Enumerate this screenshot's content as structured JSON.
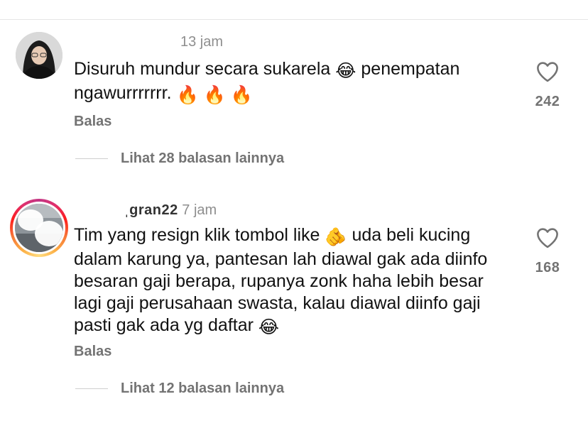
{
  "comments": [
    {
      "username": "",
      "time": "13 jam",
      "text_a": "Disuruh mundur secara sukarela ",
      "emoji_a": "😂",
      "text_b": "  penempatan ngawurrrrrrr. ",
      "emoji_b": "🔥 🔥 🔥",
      "text_c": "",
      "likes": "242",
      "reply_label": "Balas",
      "view_replies": "Lihat 28 balasan lainnya"
    },
    {
      "username": "ˌgran22",
      "time": " 7 jam",
      "text_a": "Tim yang resign klik tombol like ",
      "emoji_a": "🫵",
      "text_b": " uda beli kucing dalam karung ya, pantesan lah diawal gak ada diinfo besaran gaji berapa, rupanya zonk haha lebih besar lagi gaji perusahaan swasta, kalau diawal diinfo gaji pasti gak ada yg daftar ",
      "emoji_b": "😂",
      "text_c": "",
      "likes": "168",
      "reply_label": "Balas",
      "view_replies": "Lihat 12 balasan lainnya"
    }
  ],
  "icons": {
    "like": "heart-outline-icon"
  },
  "colors": {
    "muted": "#737373",
    "divider": "#e6e6e6"
  }
}
